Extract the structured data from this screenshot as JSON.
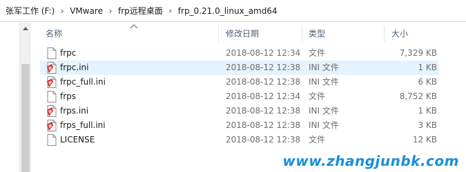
{
  "breadcrumb": [
    "张军工作 (F:)",
    "VMware",
    "frp远程桌面",
    "frp_0.21.0_linux_amd64"
  ],
  "breadcrumb_separator": "›",
  "columns": {
    "name": "名称",
    "date": "修改日期",
    "type": "类型",
    "size": "大小"
  },
  "sort_column": "name",
  "files": [
    {
      "name": "frpc",
      "date": "2018-08-12 12:34",
      "type": "文件",
      "size": "7,329 KB",
      "icon": "generic-file-icon"
    },
    {
      "name": "frpc.ini",
      "date": "2018-08-12 12:38",
      "type": "INI 文件",
      "size": "1 KB",
      "icon": "ini-file-icon",
      "selected": true
    },
    {
      "name": "frpc_full.ini",
      "date": "2018-08-12 12:38",
      "type": "INI 文件",
      "size": "6 KB",
      "icon": "ini-file-icon"
    },
    {
      "name": "frps",
      "date": "2018-08-12 12:34",
      "type": "文件",
      "size": "8,752 KB",
      "icon": "generic-file-icon"
    },
    {
      "name": "frps.ini",
      "date": "2018-08-12 12:38",
      "type": "INI 文件",
      "size": "1 KB",
      "icon": "ini-file-icon"
    },
    {
      "name": "frps_full.ini",
      "date": "2018-08-12 12:38",
      "type": "INI 文件",
      "size": "3 KB",
      "icon": "ini-file-icon"
    },
    {
      "name": "LICENSE",
      "date": "2018-08-12 12:38",
      "type": "文件",
      "size": "12 KB",
      "icon": "generic-file-icon"
    }
  ],
  "watermark": "www.zhangjunbk.com"
}
